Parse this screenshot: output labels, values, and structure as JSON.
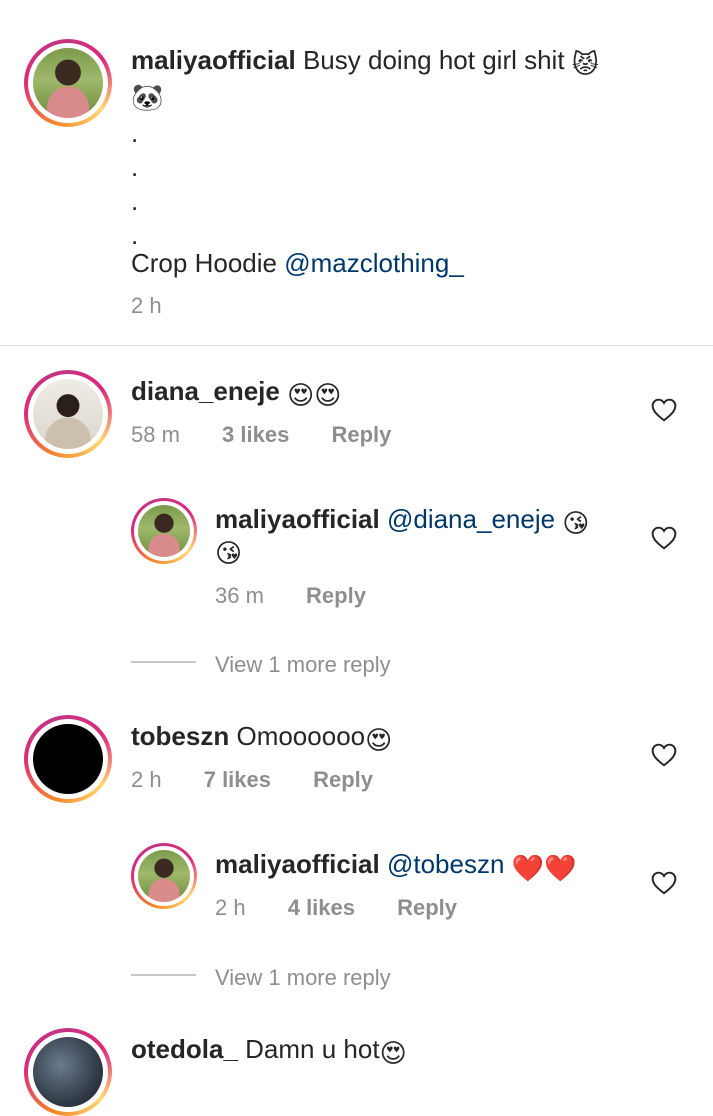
{
  "caption": {
    "username": "maliyaofficial",
    "text": "Busy doing hot girl shit",
    "emoji_1": "😾",
    "emoji_2": "🐼",
    "dots": ".",
    "crop_prefix": "Crop Hoodie",
    "crop_mention": "@mazclothing_",
    "time": "2 h"
  },
  "comments": [
    {
      "username": "diana_eneje",
      "text": "",
      "emoji": "😍😍",
      "time": "58 m",
      "likes": "3 likes",
      "reply": "Reply",
      "replies": [
        {
          "username": "maliyaofficial",
          "mention": "@diana_eneje",
          "emoji": "😘",
          "emoji_2": "😘",
          "time": "36 m",
          "reply": "Reply"
        }
      ],
      "view_more": "View 1 more reply"
    },
    {
      "username": "tobeszn",
      "text": "Omoooooo",
      "emoji": "😍",
      "time": "2 h",
      "likes": "7 likes",
      "reply": "Reply",
      "replies": [
        {
          "username": "maliyaofficial",
          "mention": "@tobeszn",
          "emoji": "❤️❤️",
          "time": "2 h",
          "likes": "4 likes",
          "reply": "Reply"
        }
      ],
      "view_more": "View 1 more reply"
    },
    {
      "username": "otedola_",
      "text": "Damn u hot",
      "emoji": "😍"
    }
  ],
  "colors": {
    "text": "#262626",
    "meta": "#8e8e8e",
    "mention": "#00376b",
    "divider": "#dbdbdb"
  },
  "icons": {
    "like": "heart-outline-icon"
  }
}
